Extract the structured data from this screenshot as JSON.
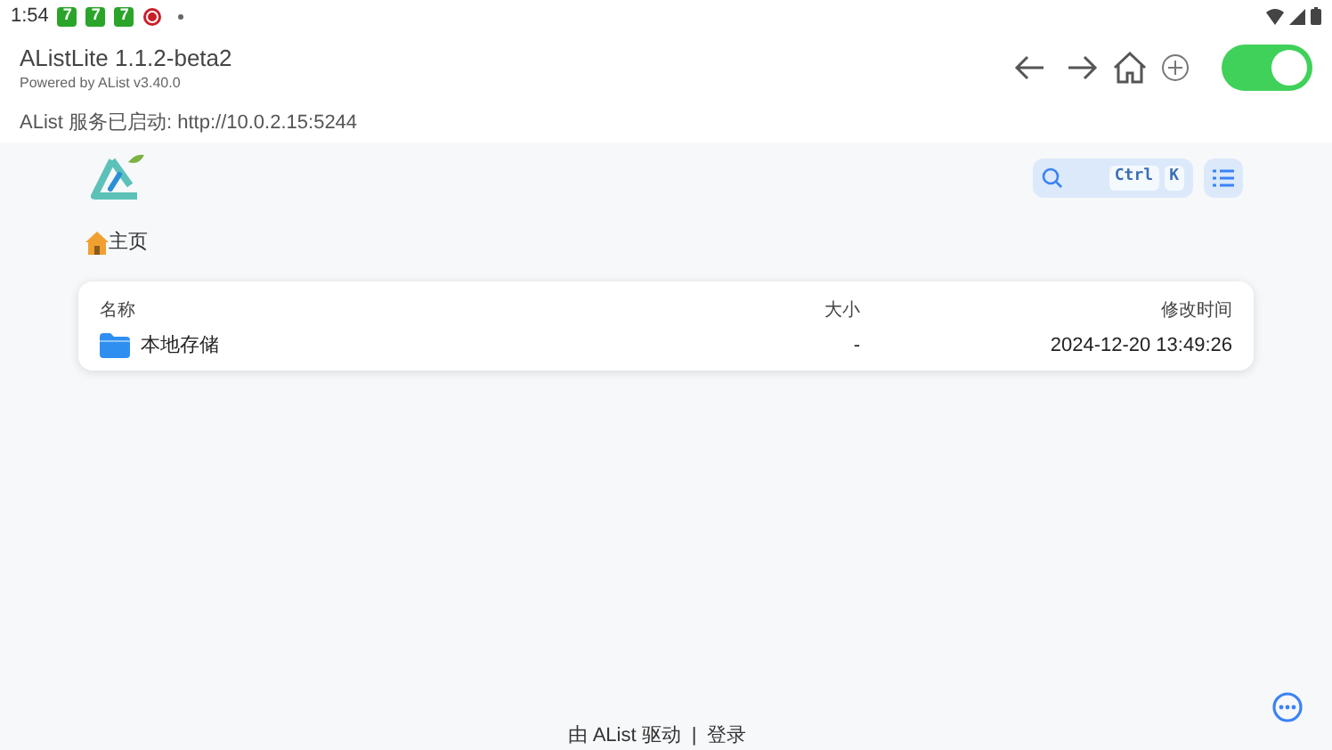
{
  "status_bar": {
    "time": "1:54",
    "notification_icons": [
      "7",
      "7",
      "7"
    ]
  },
  "app_header": {
    "title": "AListLite 1.1.2-beta2",
    "subtitle": "Powered by AList v3.40.0",
    "service_status": "AList 服务已启动: http://10.0.2.15:5244",
    "toggle": {
      "on": true
    }
  },
  "search": {
    "keys": [
      "Ctrl",
      "K"
    ]
  },
  "breadcrumb": {
    "label": "主页"
  },
  "table": {
    "columns": [
      "名称",
      "大小",
      "修改时间"
    ],
    "rows": [
      {
        "name": "本地存储",
        "size": "-",
        "modified": "2024-12-20 13:49:26"
      }
    ]
  },
  "footer": {
    "powered": "由 AList 驱动",
    "separator": "|",
    "login": "登录"
  }
}
